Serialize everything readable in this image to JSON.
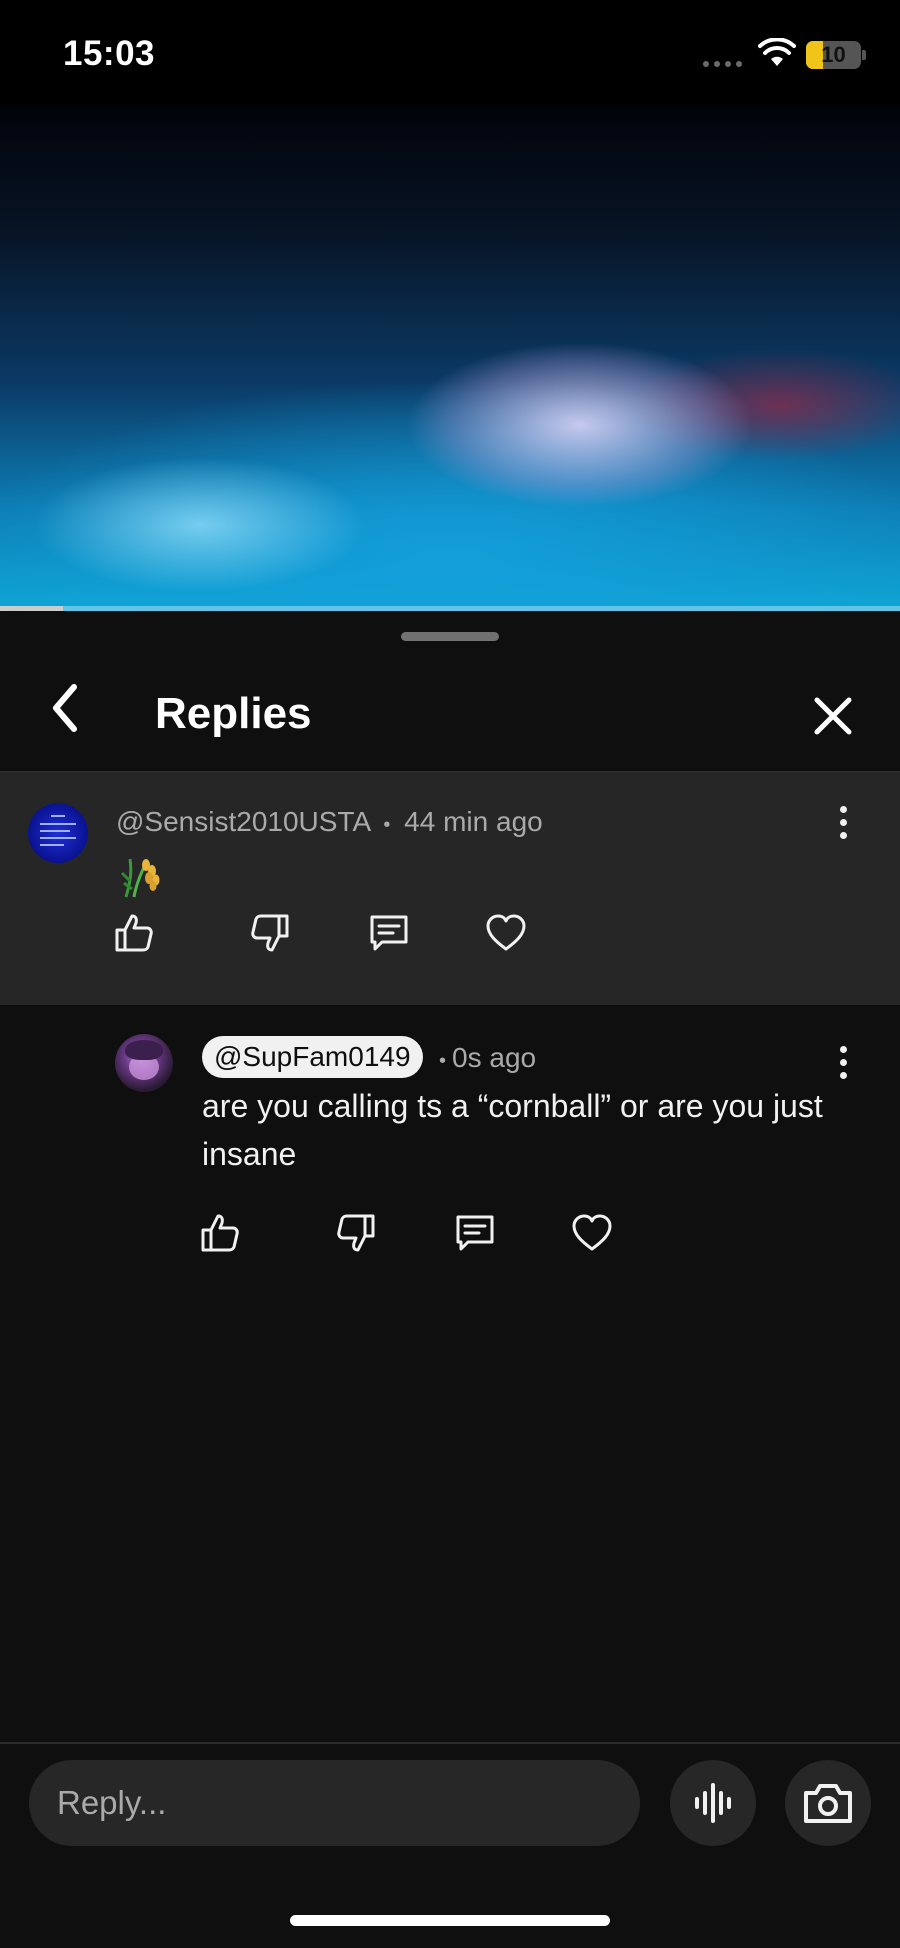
{
  "status_bar": {
    "time": "15:03",
    "battery": "10",
    "battery_level": 0.3
  },
  "video": {
    "progress": 0.07
  },
  "panel": {
    "title": "Replies"
  },
  "parent_comment": {
    "author": "@Sensist2010USTA",
    "separator": "•",
    "time": "44 min ago",
    "content_emoji": "rice-sheaf-emoji"
  },
  "reply": {
    "author": "@SupFam0149",
    "separator": "•",
    "time": "0s ago",
    "text": "are you calling ts a “cornball” or are you just insane"
  },
  "composer": {
    "placeholder": "Reply..."
  },
  "icons": {
    "back": "chevron-left-icon",
    "close": "close-icon",
    "more": "more-vert-icon",
    "like": "thumbs-up-icon",
    "dislike": "thumbs-down-icon",
    "reply": "comment-icon",
    "heart": "heart-icon",
    "voice": "voice-search-icon",
    "camera": "camera-icon"
  }
}
